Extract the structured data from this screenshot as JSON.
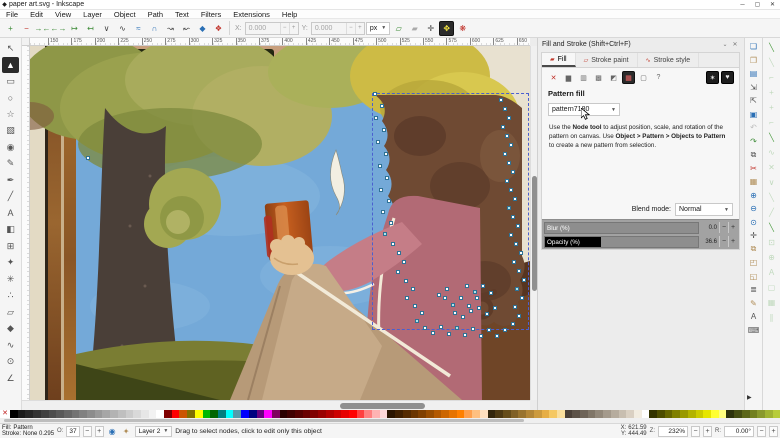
{
  "window": {
    "title": "paper art.svg - Inkscape",
    "minimize": "─",
    "maximize": "▢",
    "close": "✕"
  },
  "menu": {
    "items": [
      "File",
      "Edit",
      "View",
      "Layer",
      "Object",
      "Path",
      "Text",
      "Filters",
      "Extensions",
      "Help"
    ]
  },
  "node_toolbar": {
    "icons": [
      {
        "n": "insert-node-button",
        "g": "+",
        "cls": "c-green"
      },
      {
        "n": "delete-node-button",
        "g": "−",
        "cls": "c-red"
      },
      {
        "n": "join-nodes-button",
        "g": "→←",
        "cls": "c-green"
      },
      {
        "n": "break-nodes-button",
        "g": "←→",
        "cls": "c-green"
      },
      {
        "n": "join-with-segment-button",
        "g": "↦",
        "cls": "c-green"
      },
      {
        "n": "delete-segment-button",
        "g": "↤",
        "cls": "c-green"
      },
      {
        "n": "corner-node-button",
        "g": "∨"
      },
      {
        "n": "smooth-node-button",
        "g": "∿"
      },
      {
        "n": "symmetric-node-button",
        "g": "≈",
        "cls": "c-blue"
      },
      {
        "n": "auto-node-button",
        "g": "∩",
        "cls": "c-blue"
      },
      {
        "n": "line-to-curve-button",
        "g": "↝"
      },
      {
        "n": "curve-to-line-button",
        "g": "↜"
      },
      {
        "n": "object-to-path-button",
        "g": "◆",
        "cls": "c-blue"
      },
      {
        "n": "stroke-to-path-button",
        "g": "❖",
        "cls": "c-red"
      }
    ],
    "x_label": "X:",
    "x_value": "0.000",
    "y_label": "Y:",
    "y_value": "0.000",
    "unit": "px",
    "right_icons": [
      {
        "n": "edit-clip-path-button",
        "g": "▱",
        "cls": "c-green"
      },
      {
        "n": "edit-mask-button",
        "g": "▰",
        "cls": "c-dim"
      },
      {
        "n": "next-path-effect-button",
        "g": "✛"
      },
      {
        "n": "show-transform-handles-button",
        "g": "✥",
        "cls": "active"
      },
      {
        "n": "show-bezier-handles-button",
        "g": "❋",
        "cls": "c-red"
      }
    ]
  },
  "tools": [
    {
      "n": "selector-tool",
      "g": "↖"
    },
    {
      "n": "node-tool",
      "g": "▲",
      "cls": "active"
    },
    {
      "n": "rectangle-tool",
      "g": "▭"
    },
    {
      "n": "ellipse-tool",
      "g": "○"
    },
    {
      "n": "star-tool",
      "g": "☆"
    },
    {
      "n": "box3d-tool",
      "g": "▧"
    },
    {
      "n": "spiral-tool",
      "g": "◉"
    },
    {
      "n": "pencil-tool",
      "g": "✎"
    },
    {
      "n": "bezier-tool",
      "g": "✒"
    },
    {
      "n": "calligraphy-tool",
      "g": "╱"
    },
    {
      "n": "text-tool",
      "g": "A"
    },
    {
      "n": "gradient-tool",
      "g": "◧"
    },
    {
      "n": "mesh-tool",
      "g": "⊞"
    },
    {
      "n": "dropper-tool",
      "g": "✦"
    },
    {
      "n": "tweak-tool",
      "g": "✳"
    },
    {
      "n": "spray-tool",
      "g": "∴"
    },
    {
      "n": "eraser-tool",
      "g": "▱"
    },
    {
      "n": "bucket-tool",
      "g": "◆"
    },
    {
      "n": "connector-tool",
      "g": "∿"
    },
    {
      "n": "zoom-tool",
      "g": "⊙"
    },
    {
      "n": "measure-tool",
      "g": "∠"
    }
  ],
  "ruler": {
    "h_ticks": [
      "150",
      "175",
      "200",
      "225",
      "250",
      "275",
      "300",
      "325",
      "350",
      "375",
      "400",
      "425",
      "450",
      "475",
      "500",
      "525",
      "550",
      "575",
      "600",
      "625",
      "650"
    ]
  },
  "fill_stroke": {
    "title": "Fill and Stroke (Shift+Ctrl+F)",
    "float_btn": "⌄",
    "close_btn": "✕",
    "tabs": [
      {
        "n": "tab-fill",
        "label": "Fill",
        "g": "▰",
        "cls": "active"
      },
      {
        "n": "tab-stroke-paint",
        "label": "Stroke paint",
        "g": "▱"
      },
      {
        "n": "tab-stroke-style",
        "label": "Stroke style",
        "g": "∿"
      }
    ],
    "paint_buttons": [
      {
        "n": "no-paint-button",
        "g": "✕",
        "cls": "c-red"
      },
      {
        "n": "flat-color-button",
        "g": "▆"
      },
      {
        "n": "linear-gradient-button",
        "g": "▥"
      },
      {
        "n": "radial-gradient-button",
        "g": "▩"
      },
      {
        "n": "mesh-gradient-button",
        "g": "◩"
      },
      {
        "n": "pattern-button",
        "g": "▦",
        "cls": "active"
      },
      {
        "n": "swatch-button",
        "g": "▢"
      },
      {
        "n": "unknown-paint-button",
        "g": "?"
      }
    ],
    "fillrule_buttons": [
      {
        "n": "fill-rule-nonzero-button",
        "g": "✶",
        "cls": "dark"
      },
      {
        "n": "fill-rule-evenodd-button",
        "g": "♥",
        "cls": "dark"
      }
    ],
    "section_title": "Pattern fill",
    "pattern_name": "pattern7180",
    "hint_parts": [
      {
        "t": "Use the "
      },
      {
        "t": "Node tool",
        "cls": "b"
      },
      {
        "t": " to adjust position, scale, and rotation of the pattern on canvas. Use "
      },
      {
        "t": "Object > Pattern > Objects to Pattern",
        "cls": "b"
      },
      {
        "t": " to create a new pattern from selection."
      }
    ],
    "blend_label": "Blend mode:",
    "blend_value": "Normal",
    "blur_label": "Blur (%)",
    "blur_value": "0.0",
    "blur_pct": 0,
    "opacity_label": "Opacity (%)",
    "opacity_value": "36.6",
    "opacity_pct": 36.6
  },
  "command_bar": [
    {
      "n": "new-document-button",
      "g": "❏",
      "cls": "c-blue"
    },
    {
      "n": "open-document-button",
      "g": "❐",
      "cls": "c-tan"
    },
    {
      "n": "print-button",
      "g": "▤",
      "cls": "c-blue"
    },
    {
      "n": "export-button",
      "g": "⇲"
    },
    {
      "n": "import-button",
      "g": "⇱"
    },
    {
      "n": "save-button",
      "g": "▣",
      "cls": "c-blue"
    },
    {
      "n": "undo-button",
      "g": "↶",
      "cls": "c-dim"
    },
    {
      "n": "redo-button",
      "g": "↷",
      "cls": "c-green"
    },
    {
      "n": "copy-button",
      "g": "⧉"
    },
    {
      "n": "cut-button",
      "g": "✂",
      "cls": "c-red"
    },
    {
      "n": "paste-button",
      "g": "▦",
      "cls": "c-tan"
    },
    {
      "n": "zoom-in-button",
      "g": "⊕",
      "cls": "c-blue"
    },
    {
      "n": "zoom-out-button",
      "g": "⊖",
      "cls": "c-blue"
    },
    {
      "n": "zoom-100-button",
      "g": "⊙",
      "cls": "c-blue"
    },
    {
      "n": "zoom-fit-button",
      "g": "✛"
    },
    {
      "n": "duplicate-button",
      "g": "⧉",
      "cls": "c-tan"
    },
    {
      "n": "group-button",
      "g": "◰",
      "cls": "c-tan"
    },
    {
      "n": "ungroup-button",
      "g": "◱",
      "cls": "c-tan"
    },
    {
      "n": "align-button",
      "g": "≣"
    },
    {
      "n": "pencil-edit-button",
      "g": "✎",
      "cls": "c-tan"
    },
    {
      "n": "text-editor-button",
      "g": "A"
    },
    {
      "n": "keyboard-button",
      "g": "⌨"
    }
  ],
  "snap_bar": [
    {
      "n": "snap-enable-button",
      "g": "╲"
    },
    {
      "n": "snap-bbox-button",
      "g": "╲",
      "cls": "c-dim"
    },
    {
      "n": "snap-bbox-edge-button",
      "g": "⌐",
      "cls": "c-dim"
    },
    {
      "n": "snap-bbox-corner-button",
      "g": "+",
      "cls": "c-dim"
    },
    {
      "n": "snap-bbox-edge-mid-button",
      "g": "+",
      "cls": "c-dim"
    },
    {
      "n": "snap-bbox-center-button",
      "g": "⌐",
      "cls": "c-dim"
    },
    {
      "n": "snap-nodes-button",
      "g": "╲"
    },
    {
      "n": "snap-path-button",
      "g": "∿",
      "cls": "c-dim"
    },
    {
      "n": "snap-intersection-button",
      "g": "✕",
      "cls": "c-dim"
    },
    {
      "n": "snap-cusp-button",
      "g": "∨",
      "cls": "c-dim"
    },
    {
      "n": "snap-smooth-button",
      "g": "╲",
      "cls": "c-dim"
    },
    {
      "n": "snap-midpoint-button",
      "g": "╱",
      "cls": "c-dim"
    },
    {
      "n": "snap-others-button",
      "g": "╲"
    },
    {
      "n": "snap-center-button",
      "g": "⊡",
      "cls": "c-dim"
    },
    {
      "n": "snap-rotation-button",
      "g": "⊕",
      "cls": "c-dim"
    },
    {
      "n": "snap-text-button",
      "g": "A",
      "cls": "c-dim"
    },
    {
      "n": "snap-page-button",
      "g": "▢",
      "cls": "c-dim"
    },
    {
      "n": "snap-grid-button",
      "g": "▦",
      "cls": "c-dim"
    },
    {
      "n": "snap-guide-button",
      "g": "∥",
      "cls": "c-dim"
    }
  ],
  "palette": {
    "remove_label": "✕",
    "colors": [
      "#000000",
      "#1a1a1a",
      "#262626",
      "#333333",
      "#404040",
      "#4d4d4d",
      "#595959",
      "#666666",
      "#737373",
      "#808080",
      "#8c8c8c",
      "#999999",
      "#a6a6a6",
      "#b3b3b3",
      "#bfbfbf",
      "#cccccc",
      "#d9d9d9",
      "#e6e6e6",
      "#f2f2f2",
      "#ffffff",
      "#800000",
      "#ff0000",
      "#cc5500",
      "#807000",
      "#ffff00",
      "#00b800",
      "#006600",
      "#008080",
      "#00ffff",
      "#5599aa",
      "#0000ff",
      "#000080",
      "#660080",
      "#ff00ff",
      "#800060",
      "#2b0000",
      "#400000",
      "#550000",
      "#6a0000",
      "#800000",
      "#990000",
      "#b30000",
      "#cc0000",
      "#e60000",
      "#ff0000",
      "#ff4040",
      "#ff8080",
      "#ffb3b3",
      "#ffd9d9",
      "#2b1500",
      "#402000",
      "#552b00",
      "#6a3500",
      "#804000",
      "#994d00",
      "#b35900",
      "#cc6600",
      "#e67300",
      "#ff8000",
      "#ffa04d",
      "#ffc080",
      "#ffe0bf",
      "#33260d",
      "#4d3913",
      "#664d1a",
      "#806026",
      "#99732e",
      "#b38636",
      "#cc9a3d",
      "#e6ae45",
      "#f5c862",
      "#fadf9e",
      "#4a4038",
      "#5c5248",
      "#6e6458",
      "#807668",
      "#92887a",
      "#a49a8c",
      "#b6ac9e",
      "#c8beb0",
      "#dad0c2",
      "#f2ece0",
      "#ffffff",
      "#333300",
      "#4d4d00",
      "#666600",
      "#808000",
      "#999900",
      "#b3b300",
      "#cccc00",
      "#e6e600",
      "#ffff33",
      "#ffff80",
      "#2d330d",
      "#444d13",
      "#5b661a",
      "#728020",
      "#89992d",
      "#a0b333",
      "#b7cc3a"
    ]
  },
  "statusbar": {
    "fill_label": "Fill:",
    "fill_value": "Pattern",
    "stroke_label": "Stroke:",
    "stroke_value": "None 0.295",
    "opacity_label": "O:",
    "opacity_value": "37",
    "minus": "−",
    "plus": "+",
    "layer_value": "Layer 2",
    "message": "Drag to select nodes, click to edit only this object",
    "x_label": "X:",
    "x_value": "621.59",
    "y_label": "Y:",
    "y_value": "444.49",
    "z_label": "Z:",
    "z_value": "232%",
    "r_label": "R:",
    "r_value": "0.00°"
  },
  "canvas": {
    "colors": {
      "sky": "#74a9d8",
      "foliage": "#9aa14e",
      "trunk": "#4a3f38",
      "frame": "#c79e7c",
      "hair": "#6f4a33",
      "shirt": "#b26a75",
      "arm": "#c57d87",
      "legs": "#c2a584",
      "hand": "#e4c192",
      "cup": "#c65f1f",
      "ground": "#6a6f2b",
      "paper": "#e8e1d0",
      "selection": "#4a5fd0"
    },
    "nodes": [
      [
        345,
        48
      ],
      [
        352,
        60
      ],
      [
        346,
        72
      ],
      [
        354,
        84
      ],
      [
        348,
        96
      ],
      [
        356,
        108
      ],
      [
        350,
        120
      ],
      [
        357,
        132
      ],
      [
        351,
        144
      ],
      [
        359,
        155
      ],
      [
        353,
        166
      ],
      [
        361,
        177
      ],
      [
        355,
        188,
        1
      ],
      [
        363,
        198
      ],
      [
        369,
        207
      ],
      [
        374,
        216
      ],
      [
        368,
        226
      ],
      [
        376,
        235
      ],
      [
        383,
        243
      ],
      [
        377,
        252
      ],
      [
        385,
        260
      ],
      [
        392,
        267
      ],
      [
        387,
        275,
        1
      ],
      [
        395,
        282
      ],
      [
        403,
        287
      ],
      [
        411,
        281
      ],
      [
        419,
        288
      ],
      [
        427,
        282,
        1
      ],
      [
        435,
        289
      ],
      [
        443,
        283
      ],
      [
        451,
        290
      ],
      [
        459,
        284
      ],
      [
        467,
        290
      ],
      [
        475,
        284
      ],
      [
        483,
        278
      ],
      [
        489,
        270
      ],
      [
        485,
        261
      ],
      [
        492,
        252
      ],
      [
        487,
        243,
        1
      ],
      [
        494,
        234
      ],
      [
        489,
        225
      ],
      [
        484,
        216
      ],
      [
        491,
        207
      ],
      [
        486,
        198
      ],
      [
        481,
        189
      ],
      [
        488,
        180
      ],
      [
        483,
        171
      ],
      [
        479,
        162,
        1
      ],
      [
        485,
        153
      ],
      [
        481,
        144
      ],
      [
        477,
        135
      ],
      [
        483,
        126
      ],
      [
        479,
        117
      ],
      [
        475,
        108
      ],
      [
        481,
        99
      ],
      [
        477,
        90
      ],
      [
        473,
        81
      ],
      [
        479,
        72
      ],
      [
        475,
        63
      ],
      [
        471,
        54
      ],
      [
        415,
        252
      ],
      [
        423,
        259,
        1
      ],
      [
        431,
        252
      ],
      [
        439,
        260
      ],
      [
        447,
        252
      ],
      [
        425,
        267
      ],
      [
        433,
        271
      ],
      [
        441,
        265
      ],
      [
        417,
        243
      ],
      [
        409,
        249
      ],
      [
        437,
        240
      ],
      [
        445,
        246,
        1
      ],
      [
        453,
        240
      ],
      [
        449,
        262
      ],
      [
        457,
        268
      ],
      [
        465,
        262
      ],
      [
        461,
        247
      ],
      [
        58,
        112
      ]
    ]
  }
}
